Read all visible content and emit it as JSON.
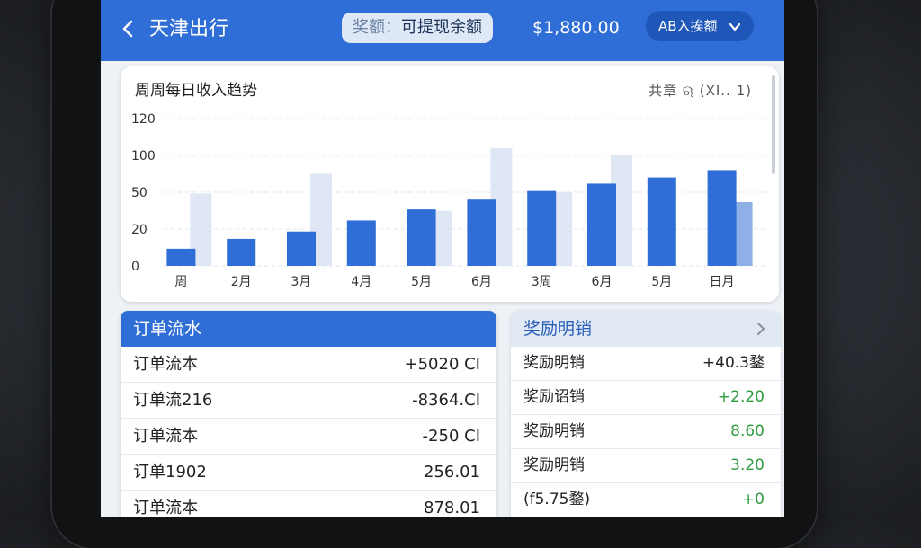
{
  "header": {
    "title": "天津出行",
    "balance_key": "奖额：",
    "balance_label": "可提现余额",
    "balance_amount": "$1,880.00",
    "account_button": "AB入挨额",
    "back_icon": "chevron-left-icon",
    "dropdown_icon": "chevron-down-icon"
  },
  "chart": {
    "title": "周周每日收入趋势",
    "tools_text": "共章 ଋ (XI.. 1)"
  },
  "chart_data": {
    "type": "bar",
    "categories": [
      "周",
      "2月",
      "3月",
      "4月",
      "5月",
      "6月",
      "3周",
      "6月",
      "5月",
      "日月"
    ],
    "y_tick_labels": [
      "120",
      "100",
      "50",
      "20",
      "0"
    ],
    "series": [
      {
        "values": [
          14,
          22,
          28,
          37,
          46,
          54,
          61,
          67,
          72,
          78
        ]
      },
      {
        "values": [
          59,
          0,
          75,
          0,
          45,
          96,
          60,
          90,
          0,
          52
        ]
      }
    ],
    "ylim": [
      0,
      120
    ],
    "grid": true,
    "legend": "none",
    "colors": {
      "primary": "#2f6ed6",
      "secondary": "#dfe7f4",
      "highlight": "#8fb0e6"
    }
  },
  "orders": {
    "title": "订单流水",
    "rows": [
      {
        "label": "订单流本",
        "value": "+5020 CI"
      },
      {
        "label": "订单流216",
        "value": "-8364.CI"
      },
      {
        "label": "订单流本",
        "value": "-250 CI"
      },
      {
        "label": "订单1902",
        "value": "256.01"
      },
      {
        "label": "订单流本",
        "value": "878.01"
      }
    ]
  },
  "rewards": {
    "title": "奖励明销",
    "more_icon": "chevron-right-icon",
    "rows": [
      {
        "label": "奖励明销",
        "value": "+40.3鍪",
        "tone": "dark"
      },
      {
        "label": "奖励诏销",
        "value": "+2.20",
        "tone": "green"
      },
      {
        "label": "奖励明销",
        "value": "8.60",
        "tone": "green"
      },
      {
        "label": "奖励明销",
        "value": "3.20",
        "tone": "green"
      },
      {
        "label": "(f5.75鍪)",
        "value": "+0",
        "tone": "green"
      }
    ]
  }
}
